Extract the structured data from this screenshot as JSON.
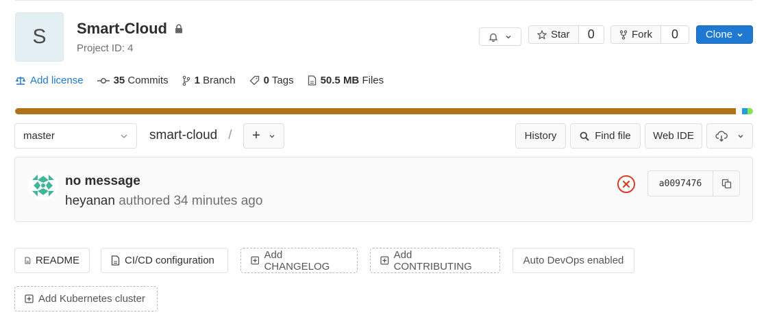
{
  "project": {
    "avatar_letter": "S",
    "name": "Smart-Cloud",
    "id_label": "Project ID: 4"
  },
  "header": {
    "star_label": "Star",
    "star_count": "0",
    "fork_label": "Fork",
    "fork_count": "0",
    "clone_label": "Clone"
  },
  "stats": {
    "license_label": "Add license",
    "commits_count": "35",
    "commits_label": "Commits",
    "branch_count": "1",
    "branch_label": "Branch",
    "tags_count": "0",
    "tags_label": "Tags",
    "files_size": "50.5 MB",
    "files_label": "Files"
  },
  "languages": [
    {
      "fraction": 0.977,
      "color": "#b07219"
    },
    {
      "fraction": 0.008,
      "color": "#ffffff"
    },
    {
      "fraction": 0.008,
      "color": "#1ea0dc"
    },
    {
      "fraction": 0.007,
      "color": "#89e051"
    }
  ],
  "nav": {
    "branch": "master",
    "path": "smart-cloud",
    "separator": "/",
    "add_symbol": "+",
    "history_label": "History",
    "findfile_label": "Find file",
    "webide_label": "Web IDE"
  },
  "commit": {
    "message": "no message",
    "author": "heyanan",
    "authored_text": "authored 34 minutes ago",
    "sha": "a0097476",
    "status_color": "#db3b21"
  },
  "quick_actions": {
    "readme": "README",
    "cicd": "CI/CD configuration",
    "changelog": "Add CHANGELOG",
    "contributing": "Add CONTRIBUTING",
    "autodevops": "Auto DevOps enabled",
    "kubernetes": "Add Kubernetes cluster"
  }
}
